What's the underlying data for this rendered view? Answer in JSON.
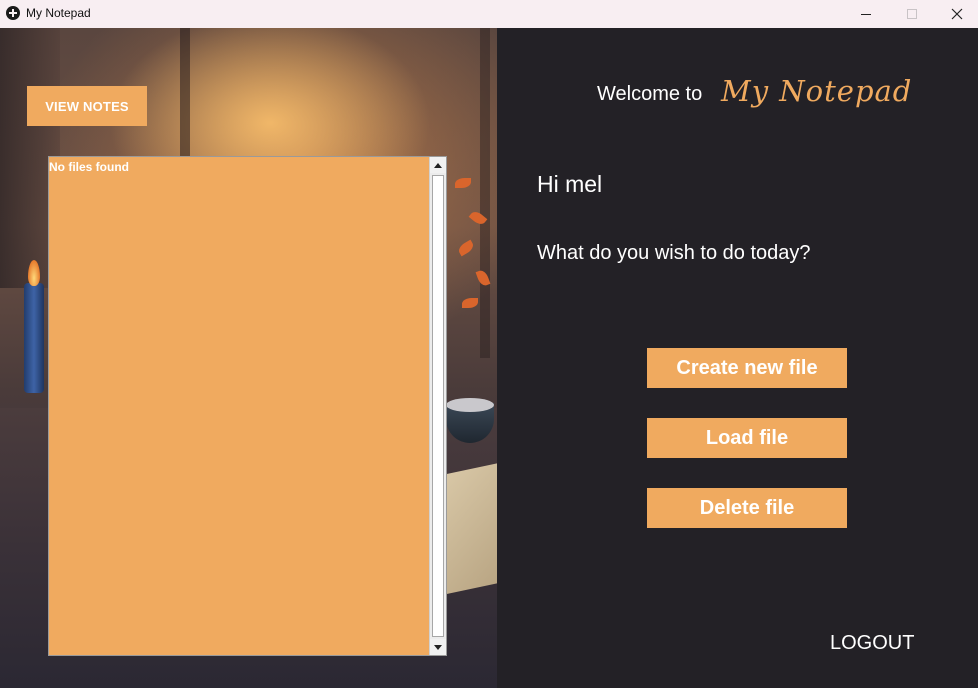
{
  "window": {
    "title": "My Notepad"
  },
  "sidebar": {
    "view_notes_label": "VIEW NOTES",
    "file_list": {
      "empty_text": "No files found"
    }
  },
  "main": {
    "welcome_text": "Welcome to",
    "brand_name": "My Notepad",
    "greeting": "Hi mel",
    "prompt": "What do you wish to do today?",
    "actions": {
      "create": "Create new file",
      "load": "Load file",
      "delete": "Delete file"
    },
    "logout_label": "LOGOUT"
  },
  "colors": {
    "accent": "#f0aa5f",
    "background": "#232126",
    "titlebar": "#f8eef2",
    "text": "#ffffff"
  },
  "icons": {
    "app": "app-icon",
    "minimize": "minimize-icon",
    "maximize": "maximize-icon",
    "close": "close-icon"
  }
}
